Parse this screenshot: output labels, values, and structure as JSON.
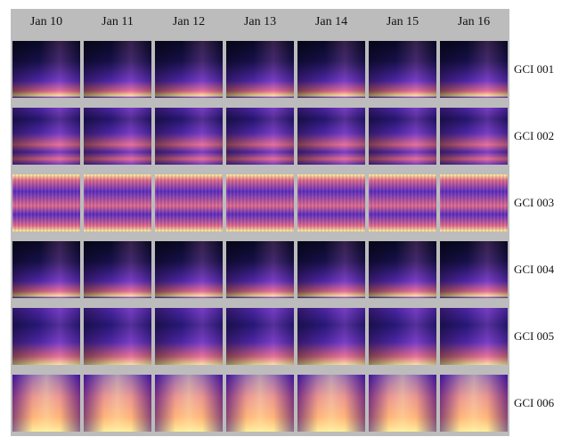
{
  "columns": [
    "Jan 10",
    "Jan 11",
    "Jan 12",
    "Jan 13",
    "Jan 14",
    "Jan 15",
    "Jan 16"
  ],
  "rows": [
    {
      "label": "GCI 001",
      "style": "dark"
    },
    {
      "label": "GCI 002",
      "style": "banded"
    },
    {
      "label": "GCI 003",
      "style": "noisy"
    },
    {
      "label": "GCI 004",
      "style": "dark"
    },
    {
      "label": "GCI 005",
      "style": "medium"
    },
    {
      "label": "GCI 006",
      "style": "bright"
    }
  ],
  "colors": {
    "background": "#bcbcbc",
    "low": "#0a0a2a",
    "mid": "#5b2cc0",
    "high": "#e06a8c",
    "peak": "#fff19a"
  }
}
